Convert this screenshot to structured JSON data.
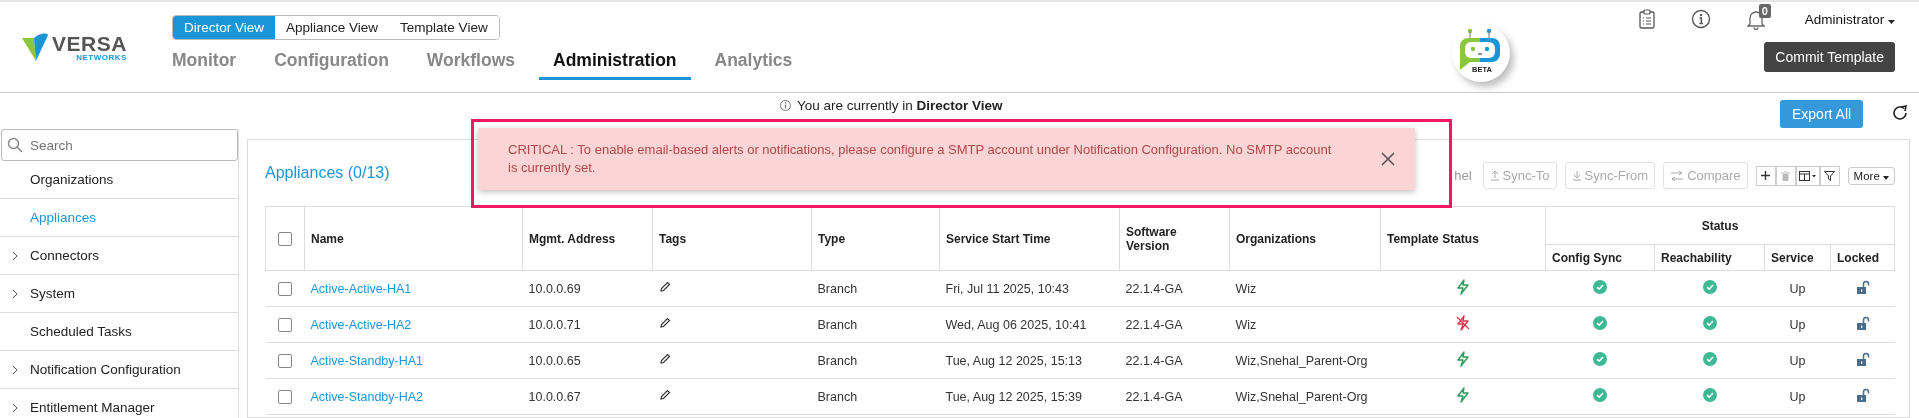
{
  "header": {
    "logo": {
      "name": "VERSA",
      "sub": "NETWORKS"
    },
    "view_toggle": [
      {
        "label": "Director View",
        "selected": true
      },
      {
        "label": "Appliance View",
        "selected": false
      },
      {
        "label": "Template View",
        "selected": false
      }
    ],
    "nav_tabs": [
      {
        "label": "Monitor",
        "selected": false
      },
      {
        "label": "Configuration",
        "selected": false
      },
      {
        "label": "Workflows",
        "selected": false
      },
      {
        "label": "Administration",
        "selected": true
      },
      {
        "label": "Analytics",
        "selected": false
      }
    ],
    "beta_badge": "BETA",
    "notification_count": "0",
    "user_menu": "Administrator",
    "commit_button": "Commit Template"
  },
  "info_bar": {
    "text": "You are currently in **Director View**",
    "export_button": "Export All"
  },
  "sidebar": {
    "search": {
      "placeholder": "Search"
    },
    "items": [
      {
        "label": "Organizations",
        "expandable": false,
        "selected": false
      },
      {
        "label": "Appliances",
        "expandable": false,
        "selected": true
      },
      {
        "label": "Connectors",
        "expandable": true,
        "selected": false
      },
      {
        "label": "System",
        "expandable": true,
        "selected": false
      },
      {
        "label": "Scheduled Tasks",
        "expandable": false,
        "selected": false
      },
      {
        "label": "Notification Configuration",
        "expandable": true,
        "selected": false
      },
      {
        "label": "Entitlement Manager",
        "expandable": true,
        "selected": false
      }
    ]
  },
  "panel": {
    "title": "Appliances (0/13)",
    "toolbar": [
      {
        "kind": "text",
        "label": "hel"
      },
      {
        "kind": "upload",
        "label": "Sync-To",
        "disabled": true
      },
      {
        "kind": "download",
        "label": "Sync-From",
        "disabled": true
      },
      {
        "kind": "compare",
        "label": "Compare",
        "disabled": true
      },
      {
        "kind": "add",
        "disabled": false
      },
      {
        "kind": "delete",
        "disabled": true
      },
      {
        "kind": "columns",
        "disabled": false
      },
      {
        "kind": "filter",
        "disabled": false
      }
    ],
    "more_button": "More",
    "alert": {
      "text": "CRITICAL : To enable email-based alerts or notifications, please configure a SMTP account under Notification Configuration. No SMTP account is currently set."
    },
    "table": {
      "select_all": {
        "checked": false
      },
      "columns": [
        "Name",
        "Mgmt. Address",
        "Tags",
        "Type",
        "Service Start Time",
        "Software Version",
        "Organizations",
        "Template Status"
      ],
      "status_group": "Status",
      "status_columns": [
        "Config Sync",
        "Reachability",
        "Service",
        "Locked"
      ],
      "rows": [
        {
          "checked": false,
          "name": "Active-Active-HA1",
          "address": "10.0.0.69",
          "type": "Branch",
          "start": "Fri, Jul 11 2025, 10:43",
          "version": "22.1.4-GA",
          "organizations": "Wiz",
          "template_in_sync": true,
          "config_sync_ok": true,
          "reachable": true,
          "service": "Up",
          "locked": false
        },
        {
          "checked": false,
          "name": "Active-Active-HA2",
          "address": "10.0.0.71",
          "type": "Branch",
          "start": "Wed, Aug 06 2025, 10:41",
          "version": "22.1.4-GA",
          "organizations": "Wiz",
          "template_in_sync": false,
          "config_sync_ok": true,
          "reachable": true,
          "service": "Up",
          "locked": false
        },
        {
          "checked": false,
          "name": "Active-Standby-HA1",
          "address": "10.0.0.65",
          "type": "Branch",
          "start": "Tue, Aug 12 2025, 15:13",
          "version": "22.1.4-GA",
          "organizations": "Wiz,Snehal_Parent-Org",
          "template_in_sync": true,
          "config_sync_ok": true,
          "reachable": true,
          "service": "Up",
          "locked": false
        },
        {
          "checked": false,
          "name": "Active-Standby-HA2",
          "address": "10.0.0.67",
          "type": "Branch",
          "start": "Tue, Aug 12 2025, 15:39",
          "version": "22.1.4-GA",
          "organizations": "Wiz,Snehal_Parent-Org",
          "template_in_sync": true,
          "config_sync_ok": true,
          "reachable": true,
          "service": "Up",
          "locked": false
        }
      ]
    }
  }
}
